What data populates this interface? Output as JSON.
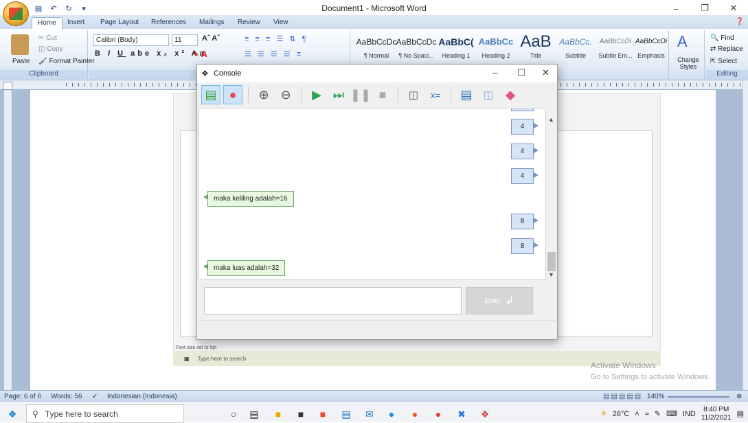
{
  "word": {
    "title": "Document1 - Microsoft Word",
    "tabs": [
      "Home",
      "Insert",
      "Page Layout",
      "References",
      "Mailings",
      "Review",
      "View"
    ],
    "active_tab": "Home",
    "clipboard": {
      "cut": "Cut",
      "copy": "Copy",
      "paste": "Paste",
      "format_painter": "Format Painter",
      "label": "Clipboard"
    },
    "font": {
      "name": "Calibri (Body)",
      "size": "11",
      "label": "Font"
    },
    "styles": [
      {
        "preview": "AaBbCcDc",
        "name": "¶ Normal"
      },
      {
        "preview": "AaBbCcDc",
        "name": "¶ No Spaci..."
      },
      {
        "preview": "AaBbC(",
        "name": "Heading 1"
      },
      {
        "preview": "AaBbCc",
        "name": "Heading 2"
      },
      {
        "preview": "AaB",
        "name": "Title"
      },
      {
        "preview": "AaBbCc.",
        "name": "Subtitle"
      },
      {
        "preview": "AaBbCcDi",
        "name": "Subtle Em..."
      },
      {
        "preview": "AaBbCcDi",
        "name": "Emphasis"
      }
    ],
    "change_styles": "Change Styles",
    "editing": {
      "find": "Find",
      "replace": "Replace",
      "select": "Select",
      "label": "Editing"
    },
    "status": {
      "page": "Page: 6 of 6",
      "words": "Words: 56",
      "language": "Indonesian (Indonesia)",
      "zoom": "140%"
    }
  },
  "console": {
    "title": "Console",
    "messages": [
      {
        "side": "right",
        "text": "4"
      },
      {
        "side": "right",
        "text": "4"
      },
      {
        "side": "right",
        "text": "4"
      },
      {
        "side": "left",
        "text": "maka keliling adalah=16"
      },
      {
        "side": "right",
        "text": "8"
      },
      {
        "side": "right",
        "text": "8"
      },
      {
        "side": "left",
        "text": "maka luas adalah=32"
      }
    ],
    "enter_label": "Enter",
    "input_value": ""
  },
  "embedded": {
    "font_note": "Font size set to 5pt",
    "search": "Type here to search",
    "activate_title": "Activate Windows",
    "activate_sub": "Go to Settings to activate Windows."
  },
  "taskbar": {
    "search_placeholder": "Type here to search",
    "weather": "26°C",
    "lang": "IND",
    "time": "8:40 PM",
    "date": "11/2/2021"
  }
}
